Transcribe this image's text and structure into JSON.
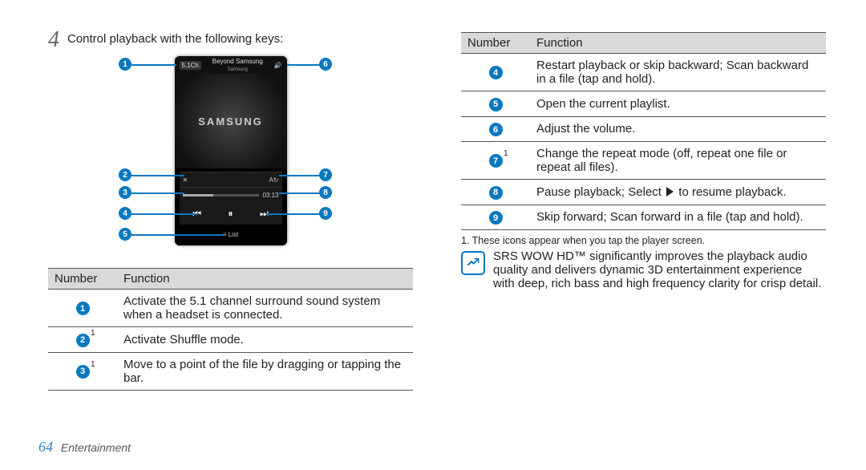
{
  "step_number": "4",
  "step_text": "Control playback with the following keys:",
  "phone": {
    "badge": "5.1Ch",
    "track_title": "Beyond Samsung",
    "track_artist": "Samsung",
    "logo": "SAMSUNG",
    "time": "03:13",
    "list_label": "≡ List"
  },
  "table_headers": {
    "number": "Number",
    "function": "Function"
  },
  "left_rows": [
    {
      "num": "1",
      "sup": "",
      "text": "Activate the 5.1 channel surround sound system when a headset is connected."
    },
    {
      "num": "2",
      "sup": "1",
      "text": "Activate Shuffle mode."
    },
    {
      "num": "3",
      "sup": "1",
      "text": "Move to a point of the file by dragging or tapping the bar."
    }
  ],
  "right_rows": [
    {
      "num": "4",
      "sup": "",
      "text": "Restart playback or skip backward; Scan backward in a file (tap and hold)."
    },
    {
      "num": "5",
      "sup": "",
      "text": "Open the current playlist."
    },
    {
      "num": "6",
      "sup": "",
      "text": "Adjust the volume."
    },
    {
      "num": "7",
      "sup": "1",
      "text": "Change the repeat mode (off, repeat one file or repeat all files)."
    },
    {
      "num": "8",
      "sup": "",
      "pre": "Pause playback; Select",
      "post": "to resume playback."
    },
    {
      "num": "9",
      "sup": "",
      "text": "Skip forward; Scan forward in a file (tap and hold)."
    }
  ],
  "footnote": "1. These icons appear when you tap the player screen.",
  "note": "SRS WOW HD™ significantly improves the playback audio quality and delivers dynamic 3D entertainment experience with deep, rich bass and high frequency clarity for crisp detail.",
  "footer": {
    "page": "64",
    "section": "Entertainment"
  }
}
